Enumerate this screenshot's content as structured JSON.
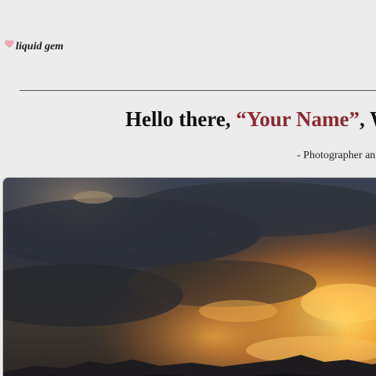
{
  "brand": {
    "name": "liquid gem",
    "icon": "heart-icon",
    "icon_color": "#f4a9b8"
  },
  "hero_text": {
    "greeting_prefix": "Hello there, ",
    "name_placeholder": "“Your Name”",
    "greeting_suffix": ", We",
    "name_color": "#8b2a32",
    "subtitle": "- Photographer an"
  },
  "hero_image": {
    "subject": "sunset-storm-clouds-over-mountains"
  }
}
